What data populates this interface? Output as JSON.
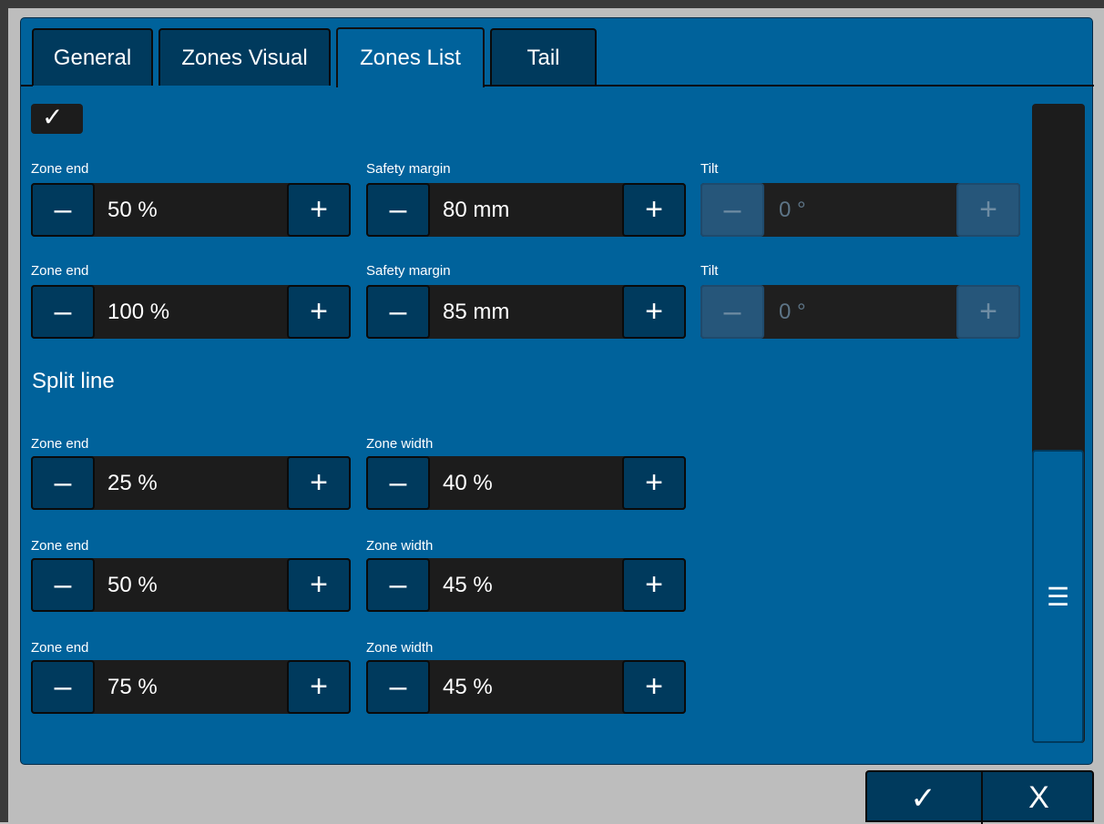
{
  "tabs": [
    {
      "label": "General",
      "active": false
    },
    {
      "label": "Zones Visual",
      "active": false
    },
    {
      "label": "Zones List",
      "active": true
    },
    {
      "label": "Tail",
      "active": false
    }
  ],
  "enable_checkbox": {
    "checked": true,
    "glyph": "✓"
  },
  "stepper_glyphs": {
    "minus": "–",
    "plus": "+"
  },
  "rows": [
    {
      "zone_end": {
        "label": "Zone end",
        "value": "50 %"
      },
      "safety_margin": {
        "label": "Safety margin",
        "value": "80 mm"
      },
      "tilt": {
        "label": "Tilt",
        "value": "0 °",
        "disabled": true
      }
    },
    {
      "zone_end": {
        "label": "Zone end",
        "value": "100 %"
      },
      "safety_margin": {
        "label": "Safety margin",
        "value": "85 mm"
      },
      "tilt": {
        "label": "Tilt",
        "value": "0 °",
        "disabled": true
      }
    }
  ],
  "split_line": {
    "title": "Split line",
    "rows": [
      {
        "zone_end": {
          "label": "Zone end",
          "value": "25 %"
        },
        "zone_width": {
          "label": "Zone width",
          "value": "40 %"
        }
      },
      {
        "zone_end": {
          "label": "Zone end",
          "value": "50 %"
        },
        "zone_width": {
          "label": "Zone width",
          "value": "45 %"
        }
      },
      {
        "zone_end": {
          "label": "Zone end",
          "value": "75 %"
        },
        "zone_width": {
          "label": "Zone width",
          "value": "45 %"
        }
      }
    ]
  },
  "scrollbar": {
    "thumb_glyph": "☰",
    "position": "bottom"
  },
  "footer": {
    "ok_glyph": "✓",
    "cancel_glyph": "X"
  },
  "colors": {
    "panel": "#00629b",
    "button": "#003a5d",
    "field": "#1c1c1c",
    "outer": "#bdbdbd"
  }
}
